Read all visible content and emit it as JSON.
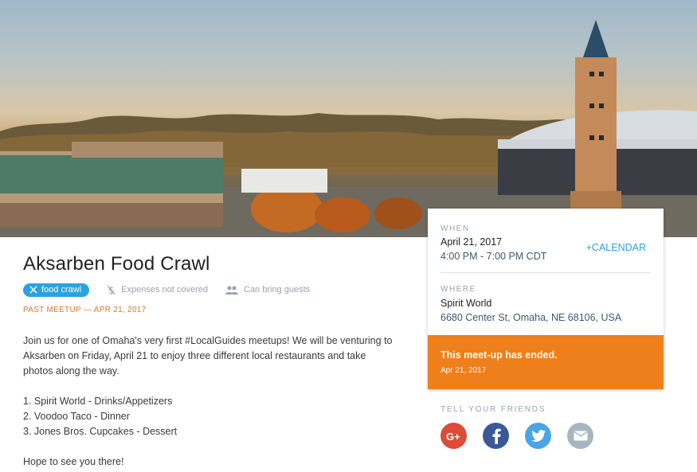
{
  "event": {
    "title": "Aksarben Food Crawl",
    "tag": "food crawl",
    "expenses": "Expenses not covered",
    "guests": "Can bring guests",
    "status_line": "PAST MEETUP — APR 21, 2017",
    "description": [
      "Join us for one of Omaha's very first #LocalGuides meetups! We will be venturing to Aksarben on Friday, April 21 to enjoy three different local restaurants and take photos along the way.",
      "1. Spirit World - Drinks/Appetizers",
      "2. Voodoo Taco - Dinner",
      "3. Jones Bros. Cupcakes - Dessert",
      "Hope to see you there!"
    ]
  },
  "card": {
    "when_label": "WHEN",
    "date": "April 21, 2017",
    "time": "4:00 PM - 7:00 PM CDT",
    "calendar_link": "+CALENDAR",
    "where_label": "WHERE",
    "place": "Spirit World",
    "address": "6680 Center St, Omaha, NE 68106, USA",
    "ended_msg": "This meet-up has ended.",
    "ended_date": "Apr 21, 2017"
  },
  "share": {
    "label": "TELL YOUR FRIENDS",
    "buttons": [
      "google-plus-icon",
      "facebook-icon",
      "twitter-icon",
      "email-icon"
    ]
  },
  "colors": {
    "accent": "#2aa2e0",
    "orange": "#ef7f1a",
    "gplus": "#dd4b39",
    "facebook": "#3b5998",
    "twitter": "#4ba4e8",
    "email": "#a8b5c0"
  }
}
